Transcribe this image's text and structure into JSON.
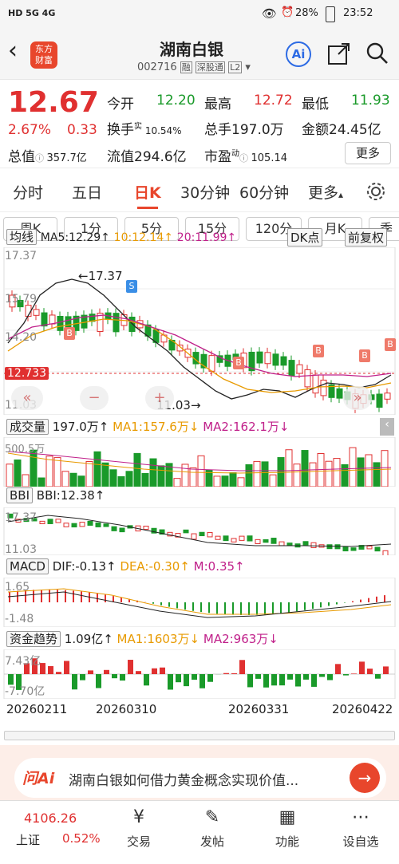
{
  "status": {
    "left": "HD 5G 4G",
    "battery": "28%",
    "time": "23:52"
  },
  "header": {
    "logo_line1": "东方",
    "logo_line2": "财富",
    "title": "湖南白银",
    "code": "002716",
    "tag1": "融",
    "tag2": "深股通",
    "tag3": "L2",
    "ai_label": "Ai"
  },
  "quote": {
    "price": "12.67",
    "pct": "2.67%",
    "chg": "0.33",
    "open_l": "今开",
    "open_v": "12.20",
    "high_l": "最高",
    "high_v": "12.72",
    "low_l": "最低",
    "low_v": "11.93",
    "turn_l": "换手",
    "turn_sup": "实",
    "turn_v": "10.54%",
    "vol_l": "总手",
    "vol_v": "197.0万",
    "amt_l": "金额",
    "amt_v": "24.45亿",
    "mcap_l": "总值",
    "mcap_v": "357.7亿",
    "float_l": "流值",
    "float_v": "294.6亿",
    "pe_l": "市盈",
    "pe_sup": "动",
    "pe_v": "105.14",
    "more": "更多"
  },
  "tabs": [
    "分时",
    "五日",
    "日K",
    "30分钟",
    "60分钟",
    "更多"
  ],
  "period_tabs": [
    "周K",
    "1分",
    "5分",
    "15分",
    "120分",
    "月K",
    "季"
  ],
  "main_chart": {
    "indicator": "均线",
    "ma5": "MA5:12.29↑",
    "ma10": "10:12.14↑",
    "ma20": "20:11.99↑",
    "dk": "DK点",
    "adj": "前复权",
    "y_top": "17.37",
    "y_mid1": "15.79",
    "y_mid2": "14.20",
    "y_cur": "12.733",
    "y_low": "11.03",
    "high_label": "←17.37",
    "low_label": "11.03→",
    "s_mark": "S",
    "b_mark": "B"
  },
  "vol_panel": {
    "name": "成交量",
    "v": "197.0万↑",
    "ma1": "MA1:157.6万↓",
    "ma2": "MA2:162.1万↓",
    "y_top": "500.5万"
  },
  "bbi_panel": {
    "name": "BBI",
    "v": "BBI:12.38↑",
    "y_top": "17.37",
    "y_low": "11.03"
  },
  "macd_panel": {
    "name": "MACD",
    "dif": "DIF:-0.13↑",
    "dea": "DEA:-0.30↑",
    "m": "M:0.35↑",
    "y_top": "1.65",
    "y_low": "-1.48"
  },
  "fund_panel": {
    "name": "资金趋势",
    "v": "1.09亿↑",
    "ma1": "MA1:1603万↓",
    "ma2": "MA2:963万↓",
    "y_top": "7.43亿",
    "y_low": "-7.70亿"
  },
  "dates": [
    "20260211",
    "20260310",
    "20260331",
    "20260422"
  ],
  "ask_ai": {
    "logo": "问Ai",
    "text": "湖南白银如何借力黄金概念实现价值..."
  },
  "bottom": {
    "index_v": "4106.26",
    "index_n": "上证",
    "index_p": "0.52%",
    "nav": [
      "交易",
      "发帖",
      "功能",
      "设自选"
    ]
  },
  "colors": {
    "up": "#e03030",
    "down": "#1a9a2a",
    "accent": "#e8462c",
    "ai_blue": "#2d6be4"
  }
}
